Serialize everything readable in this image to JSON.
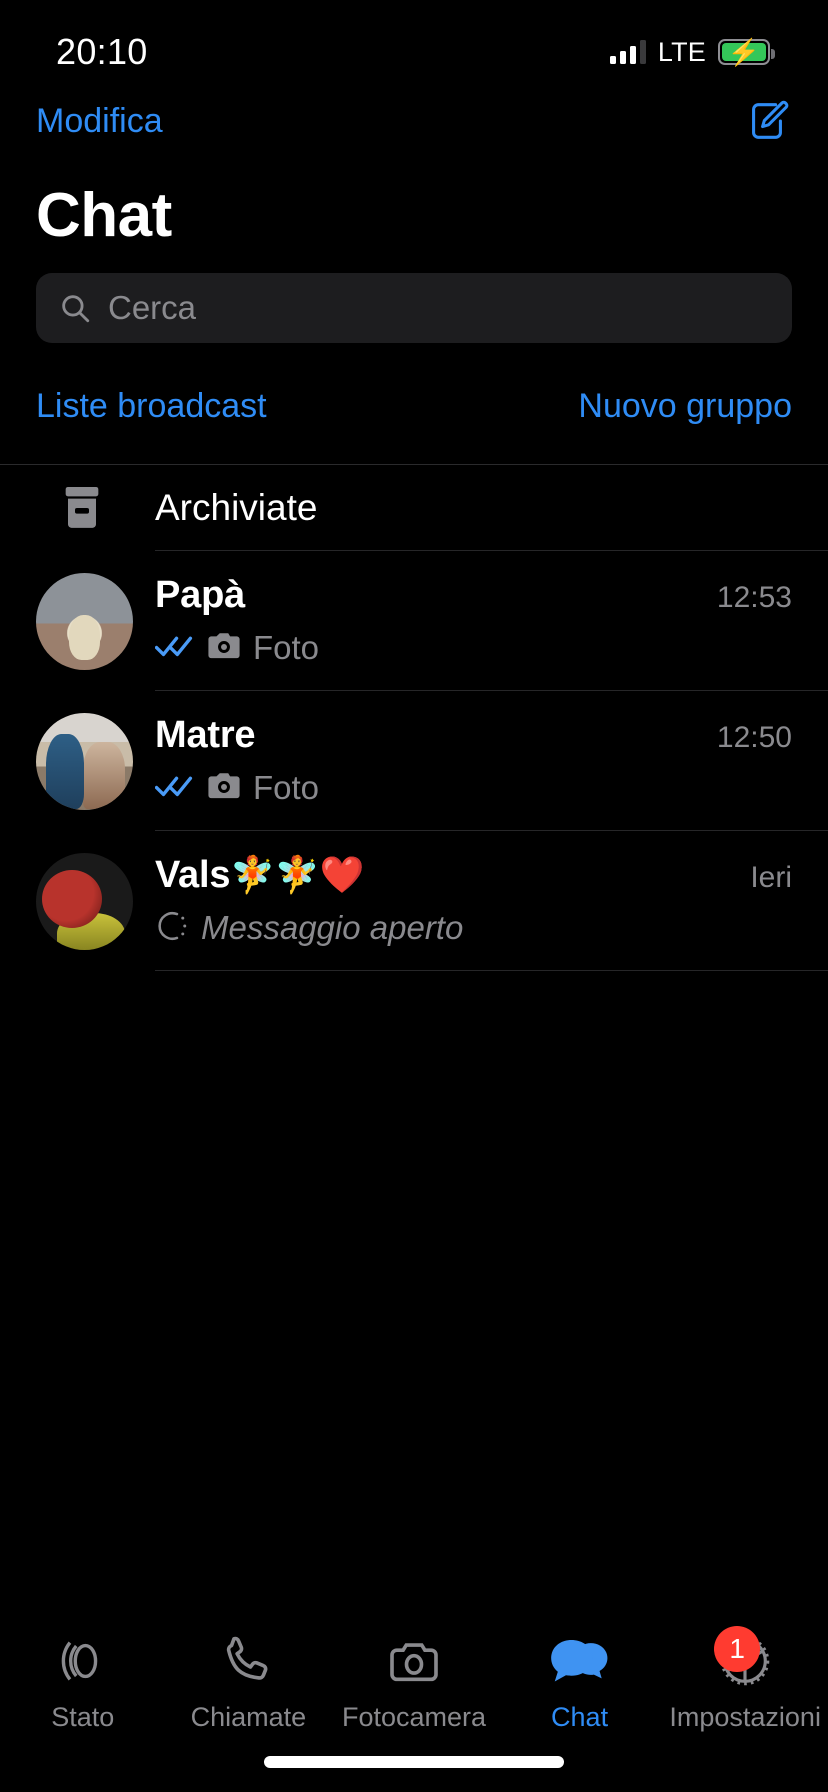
{
  "status_bar": {
    "time": "20:10",
    "network_label": "LTE",
    "signal_icon": "signal-bars-icon",
    "battery_icon": "battery-charging-icon",
    "battery_color": "#34c759"
  },
  "nav": {
    "edit_label": "Modifica",
    "compose_icon": "compose-icon",
    "accent_color": "#2f8cf5"
  },
  "header": {
    "title": "Chat"
  },
  "search": {
    "placeholder": "Cerca",
    "value": "",
    "icon": "search-icon"
  },
  "actions": {
    "broadcast_label": "Liste broadcast",
    "new_group_label": "Nuovo gruppo"
  },
  "archived": {
    "label": "Archiviate",
    "icon": "archive-box-icon"
  },
  "chats": [
    {
      "name": "Papà",
      "emoji": "",
      "time": "12:53",
      "preview": "Foto",
      "status_icon": "double-check-read-icon",
      "media_icon": "camera-icon",
      "avatar": "av-papa",
      "italic": false
    },
    {
      "name": "Matre",
      "emoji": "",
      "time": "12:50",
      "preview": "Foto",
      "status_icon": "double-check-read-icon",
      "media_icon": "camera-icon",
      "avatar": "av-matre",
      "italic": false
    },
    {
      "name": "Vals",
      "emoji": "🧚🧚❤️",
      "time": "Ieri",
      "preview": "Messaggio aperto",
      "status_icon": "",
      "media_icon": "view-once-opened-icon",
      "avatar": "av-vals",
      "italic": true
    }
  ],
  "tabs": [
    {
      "label": "Stato",
      "icon": "status-rings-icon",
      "active": false,
      "badge": ""
    },
    {
      "label": "Chiamate",
      "icon": "phone-icon",
      "active": false,
      "badge": ""
    },
    {
      "label": "Fotocamera",
      "icon": "camera-icon",
      "active": false,
      "badge": ""
    },
    {
      "label": "Chat",
      "icon": "chat-bubbles-icon",
      "active": true,
      "badge": ""
    },
    {
      "label": "Impostazioni",
      "icon": "gear-icon",
      "active": false,
      "badge": "1"
    }
  ]
}
